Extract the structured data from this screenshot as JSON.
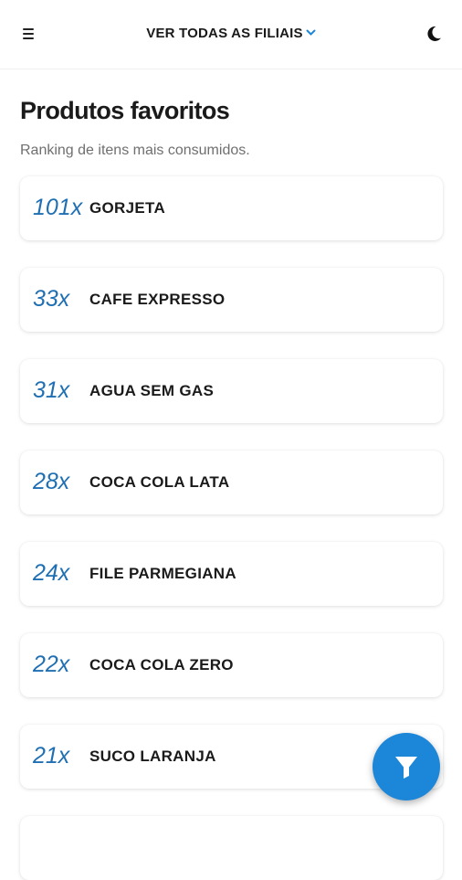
{
  "header": {
    "branch_selector": "VER TODAS AS FILIAIS",
    "menu_icon": "hamburger-menu-icon",
    "theme_icon": "moon-icon"
  },
  "page": {
    "title": "Produtos favoritos",
    "subtitle": "Ranking de itens mais consumidos."
  },
  "products": [
    {
      "count": "101x",
      "name": "GORJETA"
    },
    {
      "count": "33x",
      "name": "CAFE EXPRESSO"
    },
    {
      "count": "31x",
      "name": "AGUA SEM GAS"
    },
    {
      "count": "28x",
      "name": "COCA COLA LATA"
    },
    {
      "count": "24x",
      "name": "FILE PARMEGIANA"
    },
    {
      "count": "22x",
      "name": "COCA COLA ZERO"
    },
    {
      "count": "21x",
      "name": "SUCO LARANJA"
    }
  ],
  "fab": {
    "icon": "filter-icon"
  },
  "colors": {
    "accent": "#1c86d8",
    "count_text": "#1f6fb2"
  }
}
